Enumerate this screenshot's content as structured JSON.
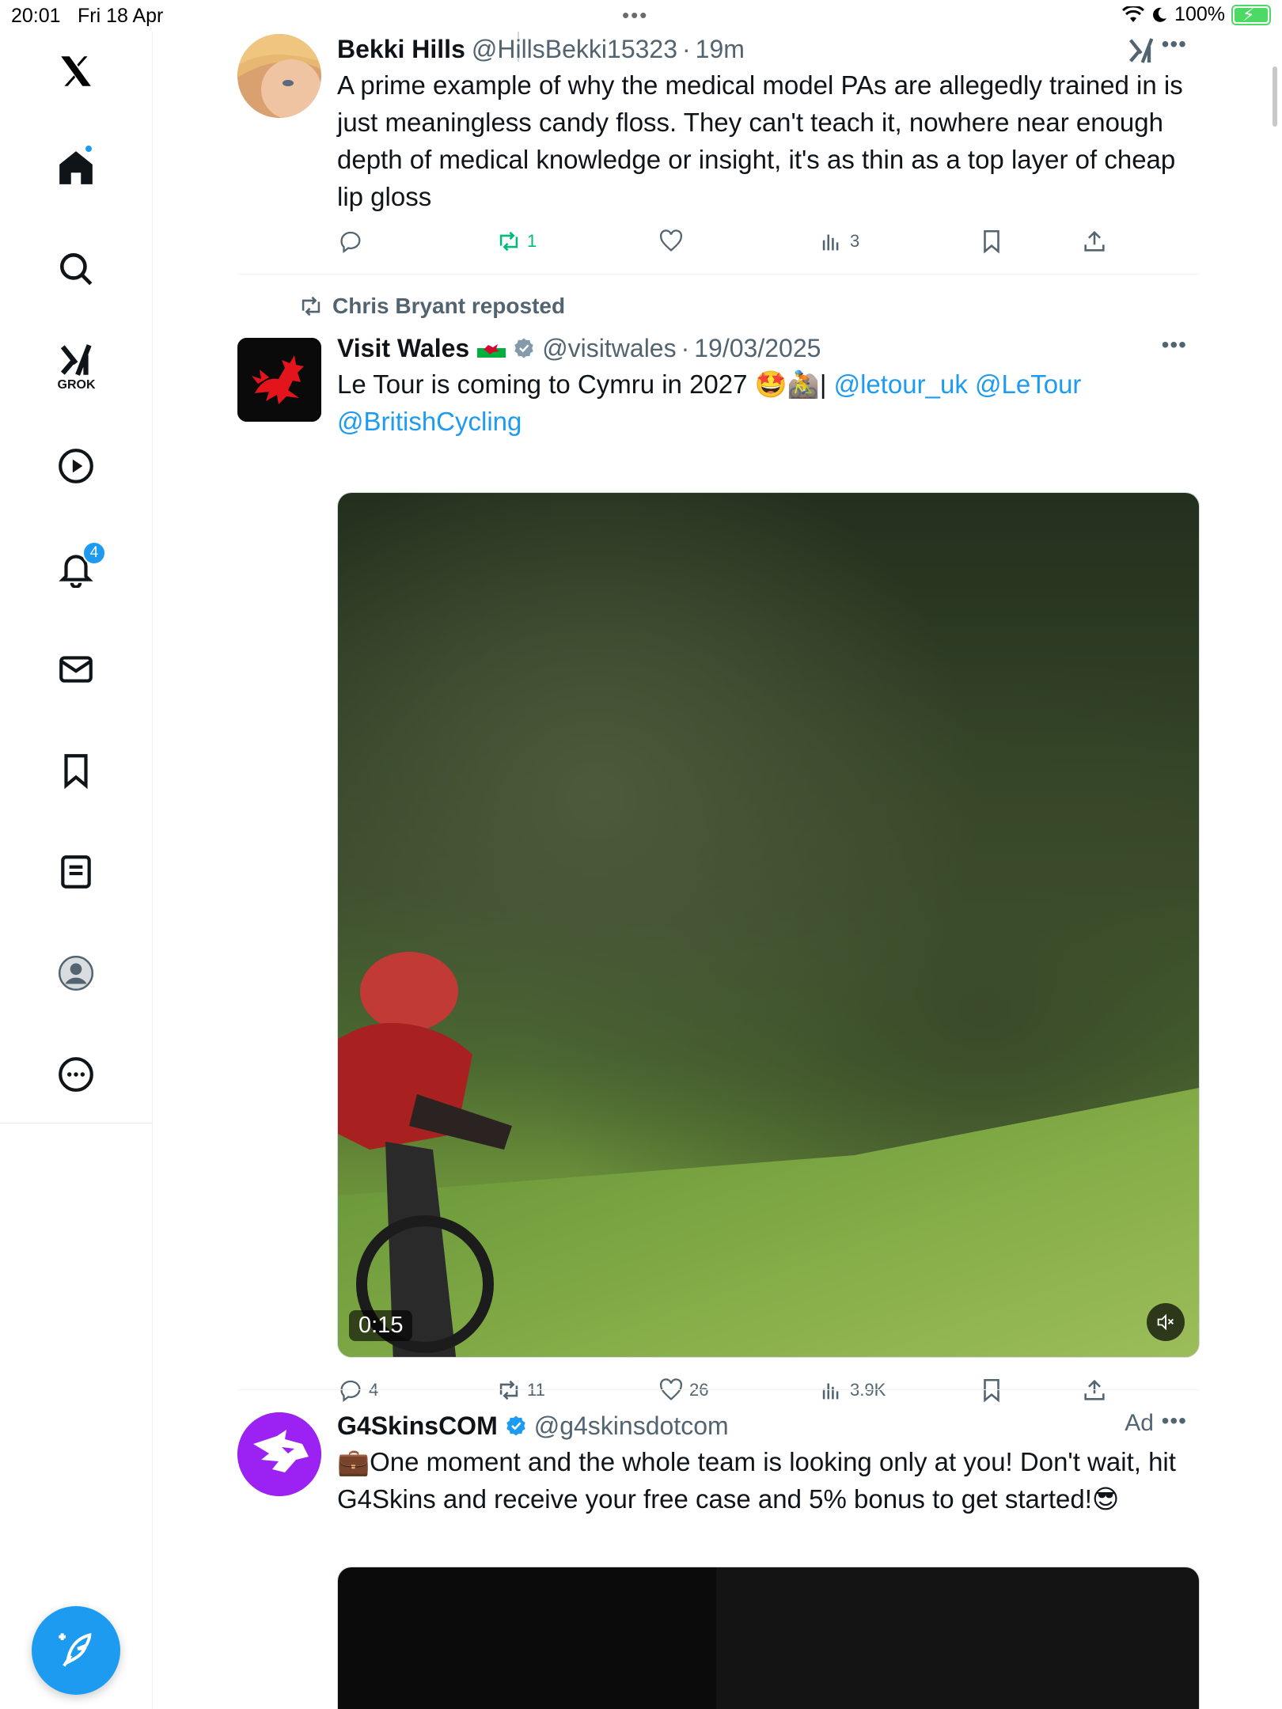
{
  "status_bar": {
    "time": "20:01",
    "date": "Fri 18 Apr",
    "battery": "100%"
  },
  "nav": {
    "items": [
      {
        "name": "home",
        "icon": "home-icon",
        "has_dot": true
      },
      {
        "name": "search",
        "icon": "search-icon"
      },
      {
        "name": "grok",
        "icon": "grok-icon",
        "label": "GROK"
      },
      {
        "name": "video",
        "icon": "play-icon"
      },
      {
        "name": "notifications",
        "icon": "bell-icon",
        "badge": "4"
      },
      {
        "name": "messages",
        "icon": "mail-icon"
      },
      {
        "name": "bookmarks",
        "icon": "bookmark-icon"
      },
      {
        "name": "lists",
        "icon": "list-icon"
      },
      {
        "name": "profile",
        "icon": "profile-icon"
      },
      {
        "name": "more",
        "icon": "more-icon"
      }
    ],
    "accent": "#1d9bf0"
  },
  "tweets": [
    {
      "name": "Bekki Hills",
      "handle": "@HillsBekki15323",
      "time": "19m",
      "text": "A prime example of why the medical model PAs are allegedly trained in is just meaningless candy floss. They can't teach it, nowhere near enough depth of medical knowledge or insight, it's as thin as a top layer of cheap lip gloss",
      "stats": {
        "replies": "",
        "reposts": "1",
        "likes": "",
        "views": "3"
      }
    },
    {
      "repost_by": "Chris Bryant reposted",
      "name": "Visit Wales",
      "handle": "@visitwales",
      "time": "19/03/2025",
      "text_plain": "Le Tour is coming to Cymru in 2027 🤩🚵| ",
      "mentions": [
        "@letour_uk",
        "@LeTour",
        "@BritishCycling"
      ],
      "video_duration": "0:15",
      "stats": {
        "replies": "4",
        "reposts": "11",
        "likes": "26",
        "views": "3.9K"
      }
    },
    {
      "name": "G4SkinsCOM",
      "handle": "@g4skinsdotcom",
      "ad_label": "Ad",
      "text": "💼One moment and the whole team is looking only at you! Don't wait, hit G4Skins and receive your free case and 5% bonus to get started!😎"
    }
  ],
  "colors": {
    "repost_green": "#00ba7c",
    "link_blue": "#1d9bf0",
    "muted": "#536471"
  }
}
